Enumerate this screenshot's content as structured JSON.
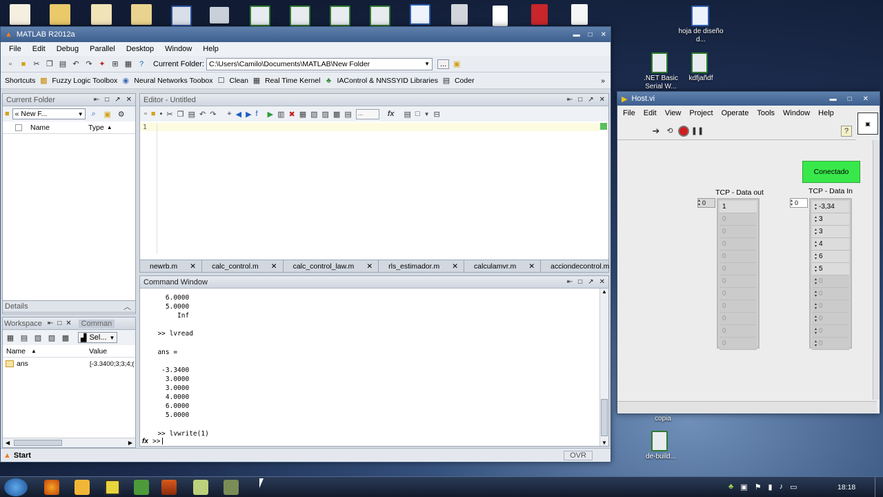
{
  "desktop": {
    "right_icons": [
      "hoja de diseño d...",
      ".NET Basic Serial W...",
      "kdfjañdf",
      "copia",
      "de-build..."
    ]
  },
  "matlab": {
    "title": "MATLAB  R2012a",
    "menu": [
      "File",
      "Edit",
      "Debug",
      "Parallel",
      "Desktop",
      "Window",
      "Help"
    ],
    "current_folder_label": "Current Folder:",
    "current_folder_path": "C:\\Users\\Camilo\\Documents\\MATLAB\\New Folder",
    "browse_label": "...",
    "shortcuts": [
      "Shortcuts",
      "Fuzzy Logic Toolbox",
      "Neural Networks Toobox",
      "Clean",
      "Real Time Kernel",
      "IAControl & NNSSYID Libraries",
      "Coder"
    ],
    "folder_panel": {
      "title": "Current Folder",
      "path": "« New F...",
      "col_name": "Name",
      "col_type": "Type",
      "details": "Details"
    },
    "workspace": {
      "title": "Workspace",
      "tab2": "Comman",
      "select": "Sel...",
      "col_name": "Name",
      "col_value": "Value",
      "var_name": "ans",
      "var_value": "[-3.3400;3;3;4;("
    },
    "editor": {
      "title": "Editor - Untitled",
      "line1": "1",
      "tabs": [
        "newrb.m",
        "calc_control.m",
        "calc_control_law.m",
        "rls_estimador.m",
        "calculamvr.m",
        "acciondecontrol.m",
        "c"
      ],
      "cell_box": "..."
    },
    "command": {
      "title": "Command Window",
      "lines": [
        "  ",
        "    6.0000",
        "    5.0000",
        "       Inf",
        "",
        "  >> lvread",
        "",
        "  ans =",
        "",
        "   -3.3400",
        "    3.0000",
        "    3.0000",
        "    4.0000",
        "    6.0000",
        "    5.0000",
        "",
        "  >> lvwrite(1)"
      ],
      "prompt": ">>",
      "fx": "fx"
    },
    "start": "Start",
    "ovr": "OVR"
  },
  "labview": {
    "title": "Host.vi",
    "menu": [
      "File",
      "Edit",
      "View",
      "Project",
      "Operate",
      "Tools",
      "Window",
      "Help"
    ],
    "button": "Conectado",
    "out_label": "TCP - Data out",
    "in_label": "TCP - Data In",
    "out_index": "0",
    "in_index": "0",
    "out_values": [
      "1",
      "0",
      "0",
      "0",
      "0",
      "0",
      "0",
      "0",
      "0",
      "0",
      "0",
      "0"
    ],
    "in_values": [
      "-3,34",
      "3",
      "3",
      "4",
      "6",
      "5",
      "0",
      "0",
      "0",
      "0",
      "0",
      "0"
    ],
    "button_color": "#38e84a"
  },
  "taskbar": {
    "clock": "18:18"
  }
}
